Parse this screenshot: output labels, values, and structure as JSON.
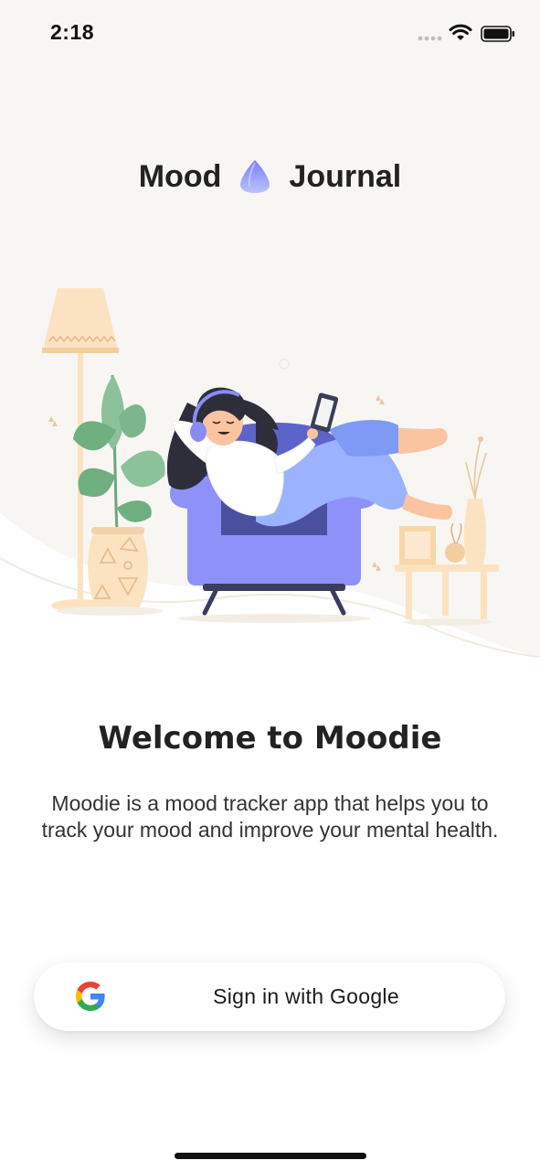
{
  "status_bar": {
    "time": "2:18",
    "icons": [
      "cellular-signal-icon",
      "wifi-icon",
      "battery-icon"
    ]
  },
  "header": {
    "title_left": "Mood",
    "title_right": "Journal",
    "logo_icon": "droplet-logo-icon"
  },
  "illustration": {
    "description_icon": "woman-relaxing-on-armchair-illustration"
  },
  "welcome": {
    "title": "Welcome to Moodie",
    "description": "Moodie is a mood tracker app that helps you to track your mood and improve your mental health."
  },
  "sign_in": {
    "label": "Sign in with Google",
    "icon": "google-icon"
  },
  "colors": {
    "background_top": "#F8F6F3",
    "accent_purple": "#8A8CF6",
    "accent_blue": "#9BB2FF",
    "cream": "#FBE3C2",
    "plant_green": "#7DB58C",
    "text": "#222222"
  }
}
